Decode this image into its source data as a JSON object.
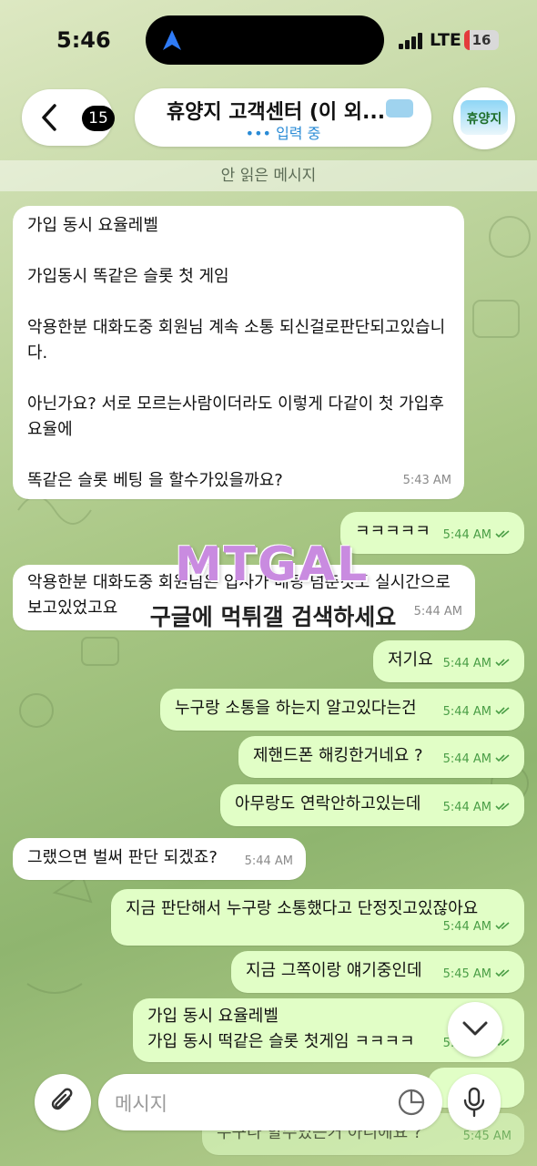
{
  "status_bar": {
    "time": "5:46",
    "network": "LTE",
    "battery": "16",
    "battery_level": 0.16
  },
  "header": {
    "back_count": "15",
    "title": "휴양지 고객센터 (이 외...",
    "typing_status": "입력 중",
    "avatar_text": "휴양지"
  },
  "unread_label": "안 읽은 메시지",
  "messages": [
    {
      "dir": "in",
      "text": "가입 동시 요율레벨\n\n가입동시 똑같은 슬롯 첫 게임\n\n악용한분 대화도중 회원님 계속 소통 되신걸로판단되고있습니다.\n\n아닌가요? 서로 모르는사람이더라도 이렇게 다같이 첫 가입후 요율에\n\n똑같은 슬롯 베팅 을 할수가있을까요?",
      "time": "5:43 AM"
    },
    {
      "dir": "out",
      "text": "ㅋㅋㅋㅋㅋ",
      "time": "5:44 AM"
    },
    {
      "dir": "in",
      "text": "악용한분 대화도중 회원님은 입사가 배팅 넘춘것도 실시간으로 보고있었고요",
      "time": "5:44 AM"
    },
    {
      "dir": "out",
      "text": "저기요",
      "time": "5:44 AM"
    },
    {
      "dir": "out",
      "text": "누구랑 소통을 하는지 알고있다는건",
      "time": "5:44 AM"
    },
    {
      "dir": "out",
      "text": "제핸드폰 해킹한거네요 ?",
      "time": "5:44 AM"
    },
    {
      "dir": "out",
      "text": "아무랑도 연락안하고있는데",
      "time": "5:44 AM"
    },
    {
      "dir": "in",
      "text": "그랬으면 벌써 판단 되겠죠?",
      "time": "5:44 AM"
    },
    {
      "dir": "out",
      "text": "지금 판단해서 누구랑 소통했다고 단정짓고있잖아요",
      "time": "5:44 AM"
    },
    {
      "dir": "out",
      "text": "지금 그쪽이랑 얘기중인데",
      "time": "5:45 AM"
    },
    {
      "dir": "out",
      "text": "가입 동시 요율레벨\n가입 동시 떡같은 슬롯 첫게임 ㅋㅋㅋㅋ",
      "time": "5:45 AM"
    },
    {
      "dir": "out",
      "text": "",
      "time": ""
    },
    {
      "dir": "out",
      "text": "누구나 할수있는거 아니에요 ?",
      "time": "5:45 AM"
    }
  ],
  "watermark": {
    "logo": "MTGAL",
    "text": "구글에 먹튀갤 검색하세요"
  },
  "input": {
    "placeholder": "메시지"
  },
  "icons": {
    "back": "chevron-left-icon",
    "location": "location-arrow-icon",
    "attach": "paperclip-icon",
    "sticker": "sticker-icon",
    "mic": "microphone-icon",
    "scroll": "chevron-down-icon",
    "read": "double-check-icon"
  },
  "colors": {
    "incoming": "#ffffff",
    "outgoing": "#e1fec6",
    "accent": "#2a8bd6",
    "check": "#4a9e46"
  }
}
